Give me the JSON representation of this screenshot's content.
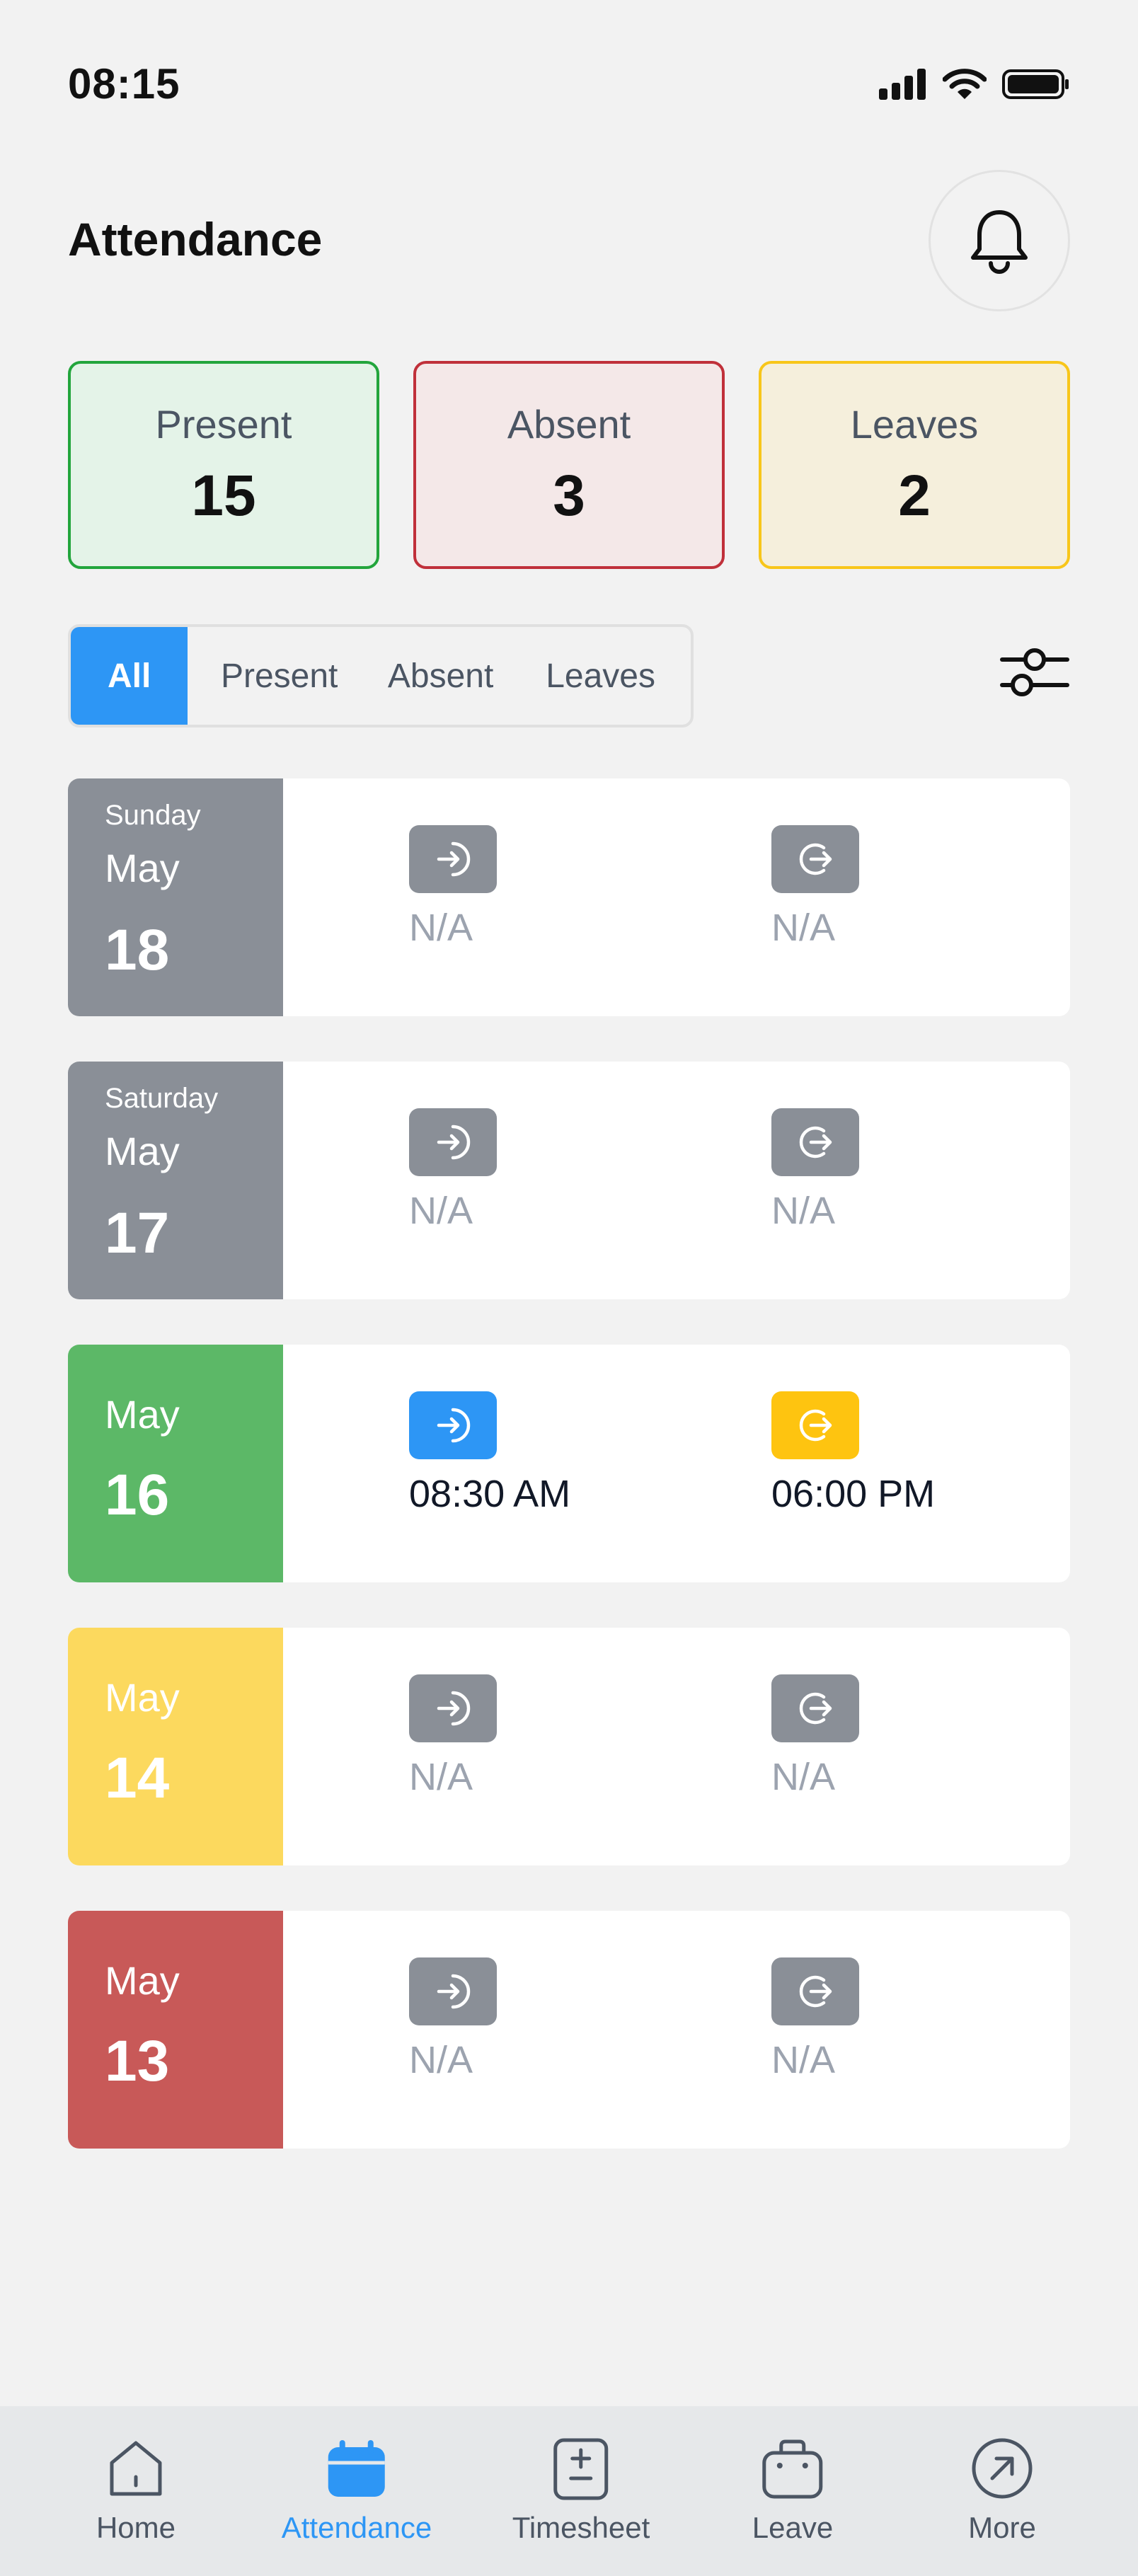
{
  "status_bar": {
    "time": "08:15"
  },
  "header": {
    "title": "Attendance"
  },
  "summary": [
    {
      "label": "Present",
      "value": "15"
    },
    {
      "label": "Absent",
      "value": "3"
    },
    {
      "label": "Leaves",
      "value": "2"
    }
  ],
  "filters": [
    "All",
    "Present",
    "Absent",
    "Leaves"
  ],
  "active_filter": "All",
  "records": [
    {
      "day": "Sunday",
      "month": "May",
      "date": "18",
      "check_in": "N/A",
      "check_out": "N/A",
      "status_color": "#8a8f97"
    },
    {
      "day": "Saturday",
      "month": "May",
      "date": "17",
      "check_in": "N/A",
      "check_out": "N/A",
      "status_color": "#8a8f97"
    },
    {
      "day": "",
      "month": "May",
      "date": "16",
      "check_in": "08:30 AM",
      "check_out": "06:00 PM",
      "status_color": "#5cb867"
    },
    {
      "day": "",
      "month": "May",
      "date": "14",
      "check_in": "N/A",
      "check_out": "N/A",
      "status_color": "#fcd95e"
    },
    {
      "day": "",
      "month": "May",
      "date": "13",
      "check_in": "N/A",
      "check_out": "N/A",
      "status_color": "#c85958"
    }
  ],
  "nav": [
    {
      "label": "Home",
      "icon": "home-icon"
    },
    {
      "label": "Attendance",
      "icon": "calendar-icon"
    },
    {
      "label": "Timesheet",
      "icon": "timesheet-icon"
    },
    {
      "label": "Leave",
      "icon": "briefcase-icon"
    },
    {
      "label": "More",
      "icon": "arrow-up-right-icon"
    }
  ],
  "active_nav": "Attendance",
  "colors": {
    "accent": "#2d96f5",
    "present": "#22a53c",
    "absent": "#c0303a",
    "leaves": "#f8c61a",
    "check_out_active": "#fec410"
  }
}
